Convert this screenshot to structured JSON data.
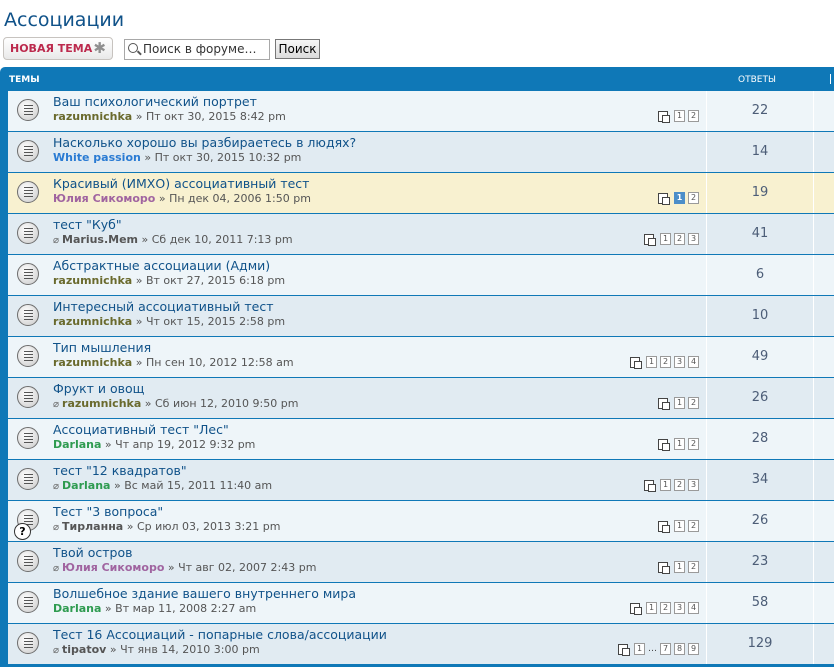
{
  "page": {
    "title": "Ассоциации"
  },
  "actions": {
    "new_topic": "НОВАЯ ТЕМА",
    "search_placeholder": "Поиск в форуме…",
    "search_button": "Поиск"
  },
  "header": {
    "topics": "ТЕМЫ",
    "replies": "ОТВЕТЫ"
  },
  "colors": {
    "header_bg": "#0f78b7",
    "link": "#105289",
    "author_olive": "#6a6a2d",
    "author_blue": "#2a7bd3",
    "author_purple": "#a064a0",
    "author_green": "#2e9b50"
  },
  "topics": [
    {
      "title": "Ваш психологический портрет",
      "author": "razumnichka",
      "author_color": "#6a6a2d",
      "date": "» Пт окт 30, 2015 8:42 pm",
      "pages": [
        "1",
        "2"
      ],
      "replies": "22",
      "attachment": false
    },
    {
      "title": "Насколько хорошо вы разбираетесь в людях?",
      "author": "White passion",
      "author_color": "#2a7bd3",
      "date": "» Пт окт 30, 2015 10:32 pm",
      "pages": [],
      "replies": "14",
      "attachment": false
    },
    {
      "title": "Красивый (ИМХО) ассоциативный тест",
      "author": "Юлия Сикоморо",
      "author_color": "#a064a0",
      "date": "» Пн дек 04, 2006 1:50 pm",
      "pages": [
        "1",
        "2"
      ],
      "current_page": "1",
      "replies": "19",
      "attachment": false
    },
    {
      "title": "тест \"Куб\"",
      "author": "Marius.Mem",
      "author_color": "#555555",
      "date": "» Сб дек 10, 2011 7:13 pm",
      "pages": [
        "1",
        "2",
        "3"
      ],
      "replies": "41",
      "attachment": true
    },
    {
      "title": "Абстрактные ассоциации (Адми)",
      "author": "razumnichka",
      "author_color": "#6a6a2d",
      "date": "» Вт окт 27, 2015 6:18 pm",
      "pages": [],
      "replies": "6",
      "attachment": false
    },
    {
      "title": "Интересный ассоциативный тест",
      "author": "razumnichka",
      "author_color": "#6a6a2d",
      "date": "» Чт окт 15, 2015 2:58 pm",
      "pages": [],
      "replies": "10",
      "attachment": false
    },
    {
      "title": "Тип мышления",
      "author": "razumnichka",
      "author_color": "#6a6a2d",
      "date": "» Пн сен 10, 2012 12:58 am",
      "pages": [
        "1",
        "2",
        "3",
        "4"
      ],
      "replies": "49",
      "attachment": false
    },
    {
      "title": "Фрукт и овощ",
      "author": "razumnichka",
      "author_color": "#6a6a2d",
      "date": "» Сб июн 12, 2010 9:50 pm",
      "pages": [
        "1",
        "2"
      ],
      "replies": "26",
      "attachment": true
    },
    {
      "title": "Ассоциативный тест \"Лес\"",
      "author": "Darlana",
      "author_color": "#2e9b50",
      "date": "» Чт апр 19, 2012 9:32 pm",
      "pages": [
        "1",
        "2"
      ],
      "replies": "28",
      "attachment": false
    },
    {
      "title": "тест \"12 квадратов\"",
      "author": "Darlana",
      "author_color": "#2e9b50",
      "date": "» Вс май 15, 2011 11:40 am",
      "pages": [
        "1",
        "2",
        "3"
      ],
      "replies": "34",
      "attachment": true
    },
    {
      "title": "Тест \"3 вопроса\"",
      "author": "Тирланна",
      "author_color": "#555555",
      "date": "» Ср июл 03, 2013 3:21 pm",
      "pages": [
        "1",
        "2"
      ],
      "replies": "26",
      "attachment": true,
      "question": true
    },
    {
      "title": "Твой остров",
      "author": "Юлия Сикоморо",
      "author_color": "#a064a0",
      "date": "» Чт авг 02, 2007 2:43 pm",
      "pages": [
        "1",
        "2"
      ],
      "replies": "23",
      "attachment": true
    },
    {
      "title": "Волшебное здание вашего внутреннего мира",
      "author": "Darlana",
      "author_color": "#2e9b50",
      "date": "» Вт мар 11, 2008 2:27 am",
      "pages": [
        "1",
        "2",
        "3",
        "4"
      ],
      "replies": "58",
      "attachment": false
    },
    {
      "title": "Тест 16 Ассоциаций - попарные слова/ассоциации",
      "author": "tipatov",
      "author_color": "#555555",
      "date": "» Чт янв 14, 2010 3:00 pm",
      "pages": [
        "1",
        "…",
        "7",
        "8",
        "9"
      ],
      "replies": "129",
      "attachment": true
    }
  ]
}
